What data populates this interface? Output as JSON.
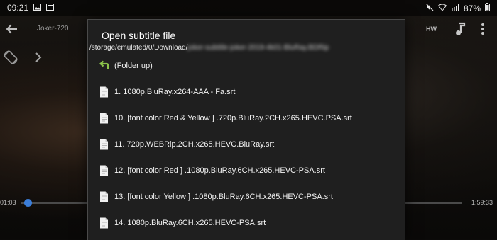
{
  "status_bar": {
    "time": "09:21",
    "battery": "87%"
  },
  "player": {
    "title": "Joker-720",
    "hw_label": "HW",
    "time_elapsed": "01:03",
    "time_total": "1:59:33",
    "progress": 0.01
  },
  "dialog": {
    "title": "Open subtitle file",
    "path_visible": "/storage/emulated/0/Download/",
    "path_blurred": "joker-subtitle-joker-2019-4k01-BluRay.BDRip",
    "folder_up": "(Folder up)",
    "files": [
      "1. 1080p.BluRay.x264-AAA - Fa.srt",
      "10. [font color Red & Yellow ] .720p.BluRay.2CH.x265.HEVC.PSA.srt",
      "11. 720p.WEBRip.2CH.x265.HEVC.BluRay.srt",
      "12. [font color Red ] .1080p.BluRay.6CH.x265.HEVC-PSA.srt",
      "13. [font color Yellow ] .1080p.BluRay.6CH.x265.HEVC-PSA.srt",
      "14. 1080p.BluRay.6CH.x265.HEVC-PSA.srt"
    ]
  },
  "colors": {
    "accent": "#3b7dd8",
    "folder_up_arrow": "#8bc34a",
    "dialog_bg": "#1f1f1f"
  },
  "icons": {
    "status_left": [
      "gallery-icon",
      "notification-icon"
    ],
    "status_right": [
      "mute-icon",
      "wifi-icon",
      "signal-icon",
      "battery-icon"
    ],
    "player": [
      "back-arrow-icon",
      "music-note-icon",
      "overflow-menu-icon",
      "screen-rotate-icon",
      "chevron-right-icon"
    ],
    "dialog": [
      "folder-up-arrow-icon",
      "file-icon"
    ]
  }
}
